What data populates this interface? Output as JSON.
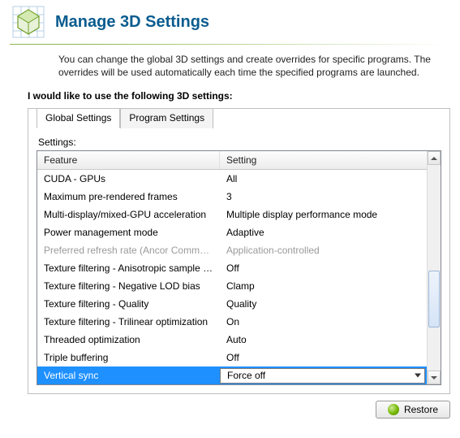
{
  "header": {
    "title": "Manage 3D Settings"
  },
  "intro": "You can change the global 3D settings and create overrides for specific programs. The overrides will be used automatically each time the specified programs are launched.",
  "section_label": "I would like to use the following 3D settings:",
  "tabs": {
    "global": "Global Settings",
    "program": "Program Settings"
  },
  "settings_label": "Settings:",
  "columns": {
    "feature": "Feature",
    "setting": "Setting"
  },
  "rows": [
    {
      "feature": "CUDA - GPUs",
      "setting": "All",
      "disabled": false,
      "selected": false
    },
    {
      "feature": "Maximum pre-rendered frames",
      "setting": "3",
      "disabled": false,
      "selected": false
    },
    {
      "feature": "Multi-display/mixed-GPU acceleration",
      "setting": "Multiple display performance mode",
      "disabled": false,
      "selected": false
    },
    {
      "feature": "Power management mode",
      "setting": "Adaptive",
      "disabled": false,
      "selected": false
    },
    {
      "feature": "Preferred refresh rate (Ancor Communicat...",
      "setting": "Application-controlled",
      "disabled": true,
      "selected": false
    },
    {
      "feature": "Texture filtering - Anisotropic sample opti...",
      "setting": "Off",
      "disabled": false,
      "selected": false
    },
    {
      "feature": "Texture filtering - Negative LOD bias",
      "setting": "Clamp",
      "disabled": false,
      "selected": false
    },
    {
      "feature": "Texture filtering - Quality",
      "setting": "Quality",
      "disabled": false,
      "selected": false
    },
    {
      "feature": "Texture filtering - Trilinear optimization",
      "setting": "On",
      "disabled": false,
      "selected": false
    },
    {
      "feature": "Threaded optimization",
      "setting": "Auto",
      "disabled": false,
      "selected": false
    },
    {
      "feature": "Triple buffering",
      "setting": "Off",
      "disabled": false,
      "selected": false
    },
    {
      "feature": "Vertical sync",
      "setting": "Force off",
      "disabled": false,
      "selected": true
    }
  ],
  "restore_label": "Restore"
}
